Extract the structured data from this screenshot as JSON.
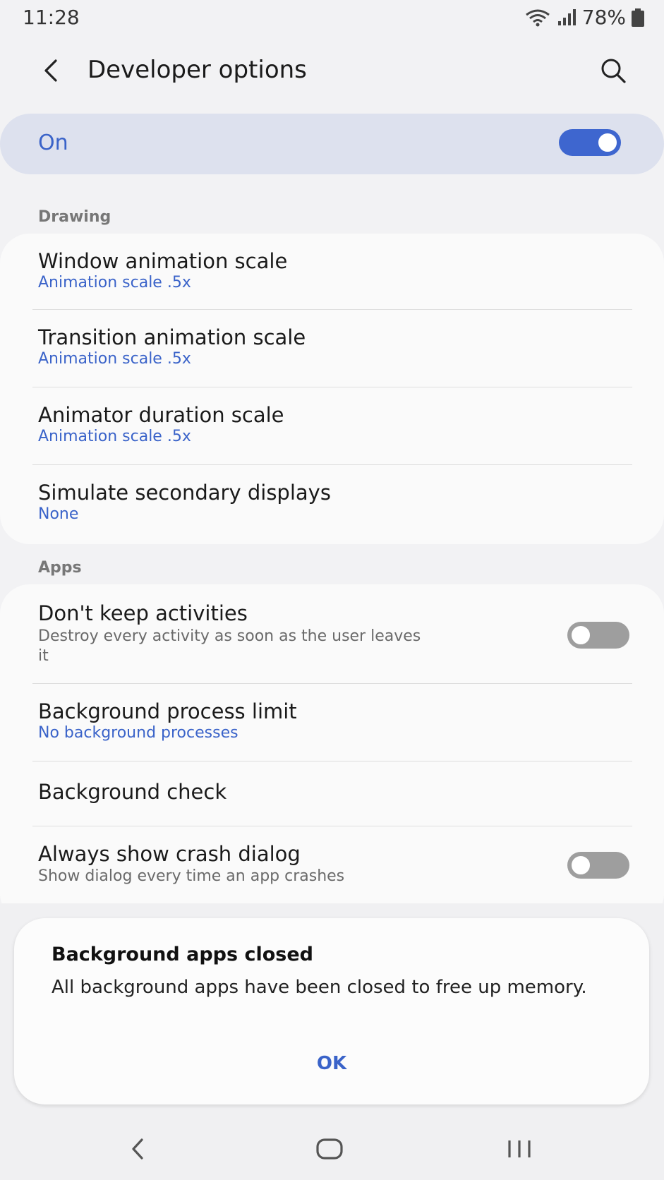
{
  "status_bar": {
    "time": "11:28",
    "battery": "78%"
  },
  "app_bar": {
    "title": "Developer options"
  },
  "master_switch": {
    "label": "On",
    "state": "on"
  },
  "sections": {
    "drawing": {
      "header": "Drawing",
      "items": [
        {
          "title": "Window animation scale",
          "subtitle": "Animation scale .5x"
        },
        {
          "title": "Transition animation scale",
          "subtitle": "Animation scale .5x"
        },
        {
          "title": "Animator duration scale",
          "subtitle": "Animation scale .5x"
        },
        {
          "title": "Simulate secondary displays",
          "subtitle": "None"
        }
      ]
    },
    "apps": {
      "header": "Apps",
      "items": [
        {
          "title": "Don't keep activities",
          "subtitle": "Destroy every activity as soon as the user leaves it",
          "toggle": "off"
        },
        {
          "title": "Background process limit",
          "subtitle": "No background processes"
        },
        {
          "title": "Background check"
        },
        {
          "title": "Always show crash dialog",
          "subtitle": "Show dialog every time an app crashes",
          "toggle": "off"
        }
      ]
    }
  },
  "dialog": {
    "title": "Background apps closed",
    "body": "All background apps have been closed to free up memory.",
    "ok_label": "OK"
  },
  "colors": {
    "accent": "#3e66cf",
    "background": "#f2f2f4",
    "card": "#fafafa"
  },
  "icons": [
    "wifi-icon",
    "signal-icon",
    "battery-icon",
    "back-arrow-icon",
    "search-icon",
    "nav-back-icon",
    "nav-home-icon",
    "nav-recents-icon"
  ]
}
